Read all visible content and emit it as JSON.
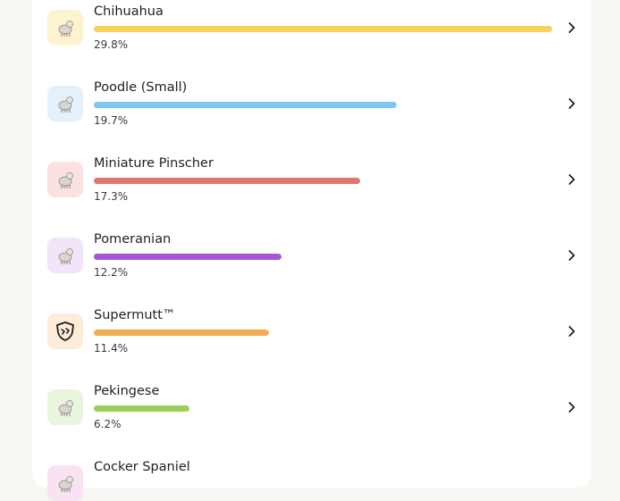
{
  "breeds": [
    {
      "name": "Chihuahua",
      "percent_label": "29.8%",
      "percent": 29.8,
      "color": "#f6d35b",
      "thumb_bg": "#fdf3cf",
      "icon": "chihuahua-icon"
    },
    {
      "name": "Poodle (Small)",
      "percent_label": "19.7%",
      "percent": 19.7,
      "color": "#7fc6f4",
      "thumb_bg": "#e2f1fb",
      "icon": "poodle-icon"
    },
    {
      "name": "Miniature Pinscher",
      "percent_label": "17.3%",
      "percent": 17.3,
      "color": "#e4746f",
      "thumb_bg": "#fbe1e0",
      "icon": "miniature-pinscher-icon"
    },
    {
      "name": "Pomeranian",
      "percent_label": "12.2%",
      "percent": 12.2,
      "color": "#a556d8",
      "thumb_bg": "#f1e5f9",
      "icon": "pomeranian-icon"
    },
    {
      "name": "Supermutt™",
      "percent_label": "11.4%",
      "percent": 11.4,
      "color": "#f2ac52",
      "thumb_bg": "#fdecd8",
      "icon": "supermutt-shield-icon"
    },
    {
      "name": "Pekingese",
      "percent_label": "6.2%",
      "percent": 6.2,
      "color": "#9ccf5a",
      "thumb_bg": "#e9f5dd",
      "icon": "pekingese-icon"
    },
    {
      "name": "Cocker Spaniel",
      "percent_label": "",
      "percent": null,
      "color": "#e6a6d6",
      "thumb_bg": "#f9e3f2",
      "icon": "cocker-spaniel-icon"
    }
  ]
}
